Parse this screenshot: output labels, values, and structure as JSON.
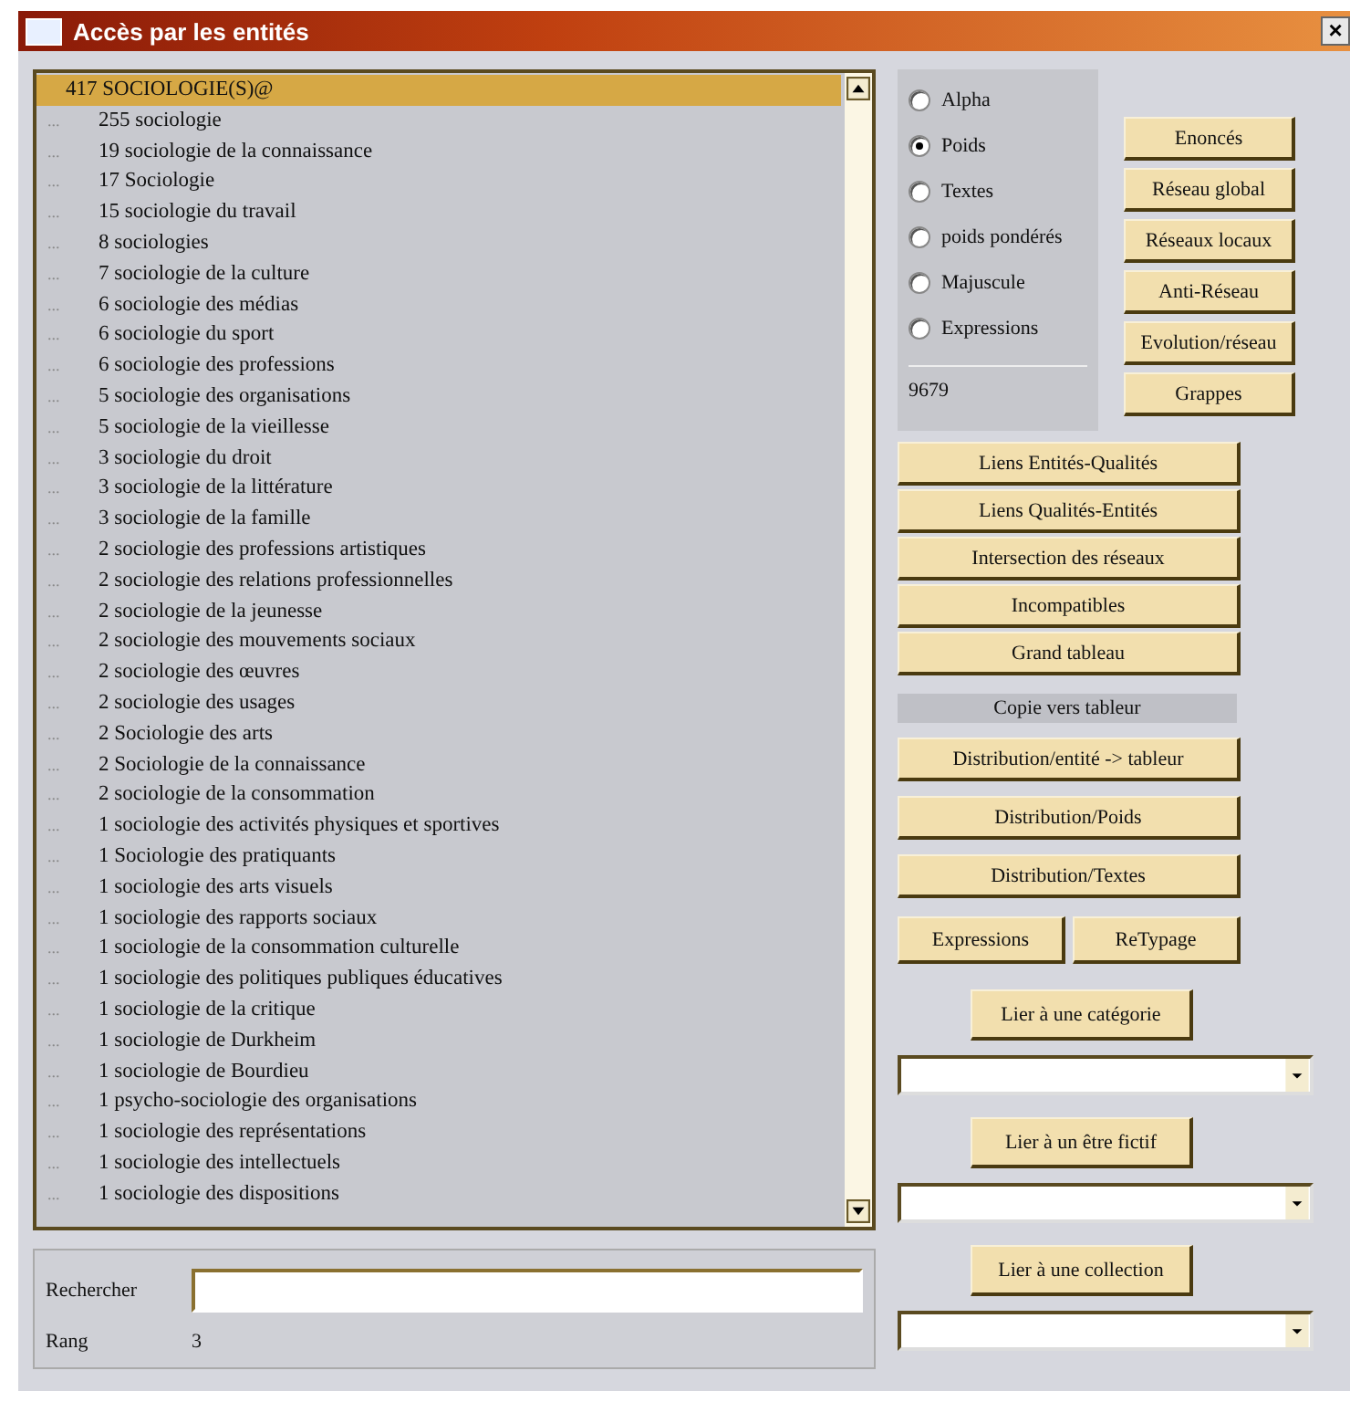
{
  "window": {
    "title": "Accès par les entités",
    "close": "×"
  },
  "list": {
    "rows": [
      {
        "label": "417 SOCIOLOGIE(S)@",
        "selected": true
      },
      {
        "prefix": "...",
        "label": "255 sociologie",
        "selected": false
      },
      {
        "prefix": "...",
        "label": "19 sociologie de la connaissance",
        "selected": false
      },
      {
        "prefix": "...",
        "label": "17 Sociologie",
        "selected": false
      },
      {
        "prefix": "...",
        "label": "15 sociologie du travail",
        "selected": false
      },
      {
        "prefix": "...",
        "label": "8 sociologies",
        "selected": false
      },
      {
        "prefix": "...",
        "label": "7 sociologie de la culture",
        "selected": false
      },
      {
        "prefix": "...",
        "label": "6 sociologie des médias",
        "selected": false
      },
      {
        "prefix": "...",
        "label": "6 sociologie du sport",
        "selected": false
      },
      {
        "prefix": "...",
        "label": "6 sociologie des professions",
        "selected": false
      },
      {
        "prefix": "...",
        "label": "5 sociologie des organisations",
        "selected": false
      },
      {
        "prefix": "...",
        "label": "5 sociologie de la vieillesse",
        "selected": false
      },
      {
        "prefix": "...",
        "label": "3 sociologie du droit",
        "selected": false
      },
      {
        "prefix": "...",
        "label": "3 sociologie de la littérature",
        "selected": false
      },
      {
        "prefix": "...",
        "label": "3 sociologie de la famille",
        "selected": false
      },
      {
        "prefix": "...",
        "label": "2 sociologie des professions artistiques",
        "selected": false
      },
      {
        "prefix": "...",
        "label": "2 sociologie des relations professionnelles",
        "selected": false
      },
      {
        "prefix": "...",
        "label": "2 sociologie de la jeunesse",
        "selected": false
      },
      {
        "prefix": "...",
        "label": "2 sociologie des mouvements sociaux",
        "selected": false
      },
      {
        "prefix": "...",
        "label": "2 sociologie des œuvres",
        "selected": false
      },
      {
        "prefix": "...",
        "label": "2 sociologie des usages",
        "selected": false
      },
      {
        "prefix": "...",
        "label": "2 Sociologie des arts",
        "selected": false
      },
      {
        "prefix": "...",
        "label": "2 Sociologie de la connaissance",
        "selected": false
      },
      {
        "prefix": "...",
        "label": "2 sociologie de la consommation",
        "selected": false
      },
      {
        "prefix": "...",
        "label": "1 sociologie des activités physiques et sportives",
        "selected": false
      },
      {
        "prefix": "...",
        "label": "1 Sociologie des pratiquants",
        "selected": false
      },
      {
        "prefix": "...",
        "label": "1 sociologie des arts visuels",
        "selected": false
      },
      {
        "prefix": "...",
        "label": "1 sociologie des rapports sociaux",
        "selected": false
      },
      {
        "prefix": "...",
        "label": "1 sociologie de la consommation culturelle",
        "selected": false
      },
      {
        "prefix": "...",
        "label": "1 sociologie des politiques publiques éducatives",
        "selected": false
      },
      {
        "prefix": "...",
        "label": "1 sociologie de la critique",
        "selected": false
      },
      {
        "prefix": "...",
        "label": "1 sociologie de Durkheim",
        "selected": false
      },
      {
        "prefix": "...",
        "label": "1 sociologie de Bourdieu",
        "selected": false
      },
      {
        "prefix": "...",
        "label": "1 psycho-sociologie des organisations",
        "selected": false
      },
      {
        "prefix": "...",
        "label": "1 sociologie des représentations",
        "selected": false
      },
      {
        "prefix": "...",
        "label": "1 sociologie des intellectuels",
        "selected": false
      },
      {
        "prefix": "...",
        "label": "1 sociologie des dispositions",
        "selected": false
      }
    ]
  },
  "search": {
    "label": "Rechercher",
    "rank_label": "Rang",
    "rank": "3"
  },
  "sort": {
    "options": [
      {
        "label": "Alpha",
        "selected": false
      },
      {
        "label": "Poids",
        "selected": true
      },
      {
        "label": "Textes",
        "selected": false
      },
      {
        "label": "poids pondérés",
        "selected": false
      },
      {
        "label": "Majuscule",
        "selected": false
      },
      {
        "label": "Expressions",
        "selected": false
      }
    ],
    "count": "9679"
  },
  "side_buttons": [
    "Enoncés",
    "Réseau global",
    "Réseaux locaux",
    "Anti-Réseau",
    "Evolution/réseau",
    "Grappes"
  ],
  "link_buttons": [
    "Liens Entités-Qualités",
    "Liens Qualités-Entités",
    "Intersection des réseaux",
    "Incompatibles",
    "Grand tableau"
  ],
  "copy_label": "Copie vers tableur",
  "distribution_buttons": [
    "Distribution/entité -> tableur",
    "Distribution/Poids",
    "Distribution/Textes"
  ],
  "pair_buttons": [
    "Expressions",
    "ReTypage"
  ],
  "attach": [
    {
      "button": "Lier à une catégorie"
    },
    {
      "button": "Lier à un être fictif"
    },
    {
      "button": "Lier à une collection"
    }
  ]
}
